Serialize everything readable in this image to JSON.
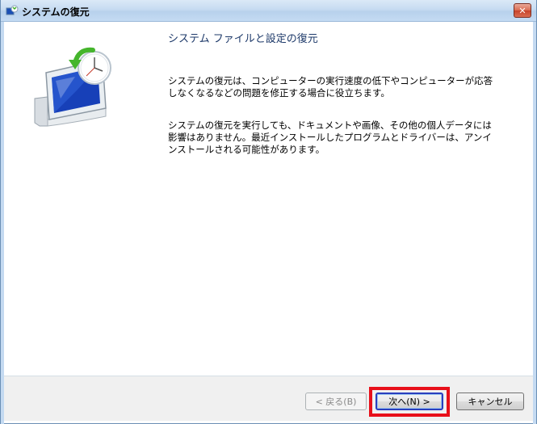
{
  "window": {
    "title": "システムの復元",
    "close_label": "✕"
  },
  "main": {
    "heading": "システム ファイルと設定の復元",
    "paragraph1": "システムの復元は、コンピューターの実行速度の低下やコンピューターが応答しなくなるなどの問題を修正する場合に役立ちます。",
    "paragraph2": "システムの復元を実行しても、ドキュメントや画像、その他の個人データには影響はありません。最近インストールしたプログラムとドライバーは、アンインストールされる可能性があります。"
  },
  "buttons": {
    "back_label": "< 戻る(B)",
    "next_label": "次へ(N) >",
    "cancel_label": "キャンセル"
  },
  "icons": {
    "title": "system-restore-icon",
    "hero": "system-restore-monitor-icon"
  },
  "colors": {
    "highlight": "#e8101a",
    "heading": "#1e3a6a",
    "default_button_border": "#2a3fbe"
  }
}
